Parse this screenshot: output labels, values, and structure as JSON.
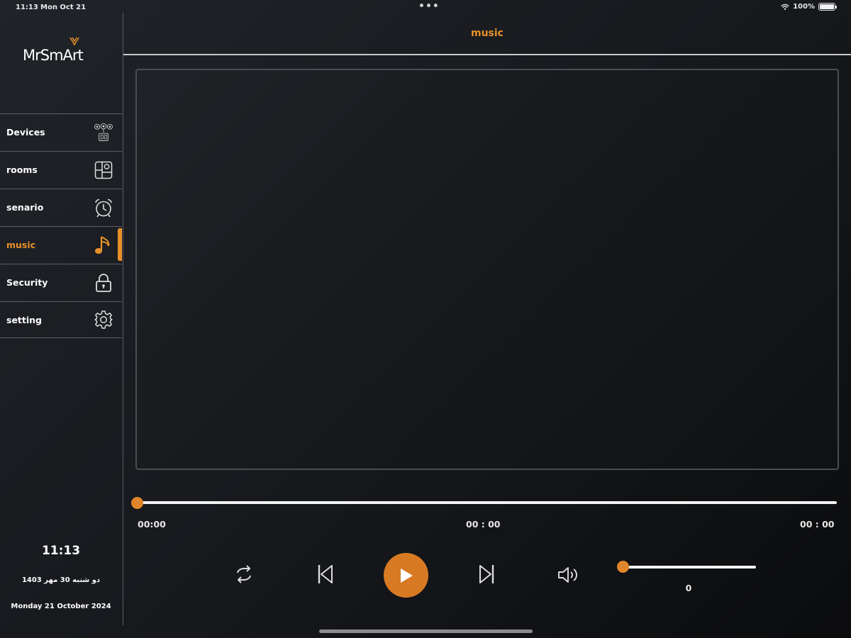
{
  "status_bar": {
    "time": "11:13",
    "date": "Mon Oct 21",
    "dots": "•••",
    "battery": "100%",
    "battery_level": 1.0
  },
  "sidebar": {
    "brand": "MrSmArt",
    "items": [
      {
        "label": "Devices",
        "icon": "devices-icon"
      },
      {
        "label": "rooms",
        "icon": "rooms-icon"
      },
      {
        "label": "senario",
        "icon": "alarm-clock-icon"
      },
      {
        "label": "music",
        "icon": "music-note-icon",
        "active": true
      },
      {
        "label": "Security",
        "icon": "lock-icon"
      },
      {
        "label": "setting",
        "icon": "gear-icon"
      }
    ],
    "clock": "11:13",
    "date_persian": "دو شنبه 30 مهر 1403",
    "date_english": "Monday 21 October 2024"
  },
  "header": {
    "title": "music"
  },
  "player": {
    "progress": 0,
    "time_elapsed": "00:00",
    "time_middle": "00 : 00",
    "time_total": "00 : 00",
    "volume": 0,
    "volume_label": "0",
    "controls": [
      "repeat-icon",
      "previous-track-icon",
      "play-icon",
      "next-track-icon",
      "speaker-volume-icon"
    ]
  },
  "colors": {
    "accent": "#e8912a",
    "play_button": "#d87a23",
    "background": "#16181c",
    "divider": "#5c5f65"
  }
}
